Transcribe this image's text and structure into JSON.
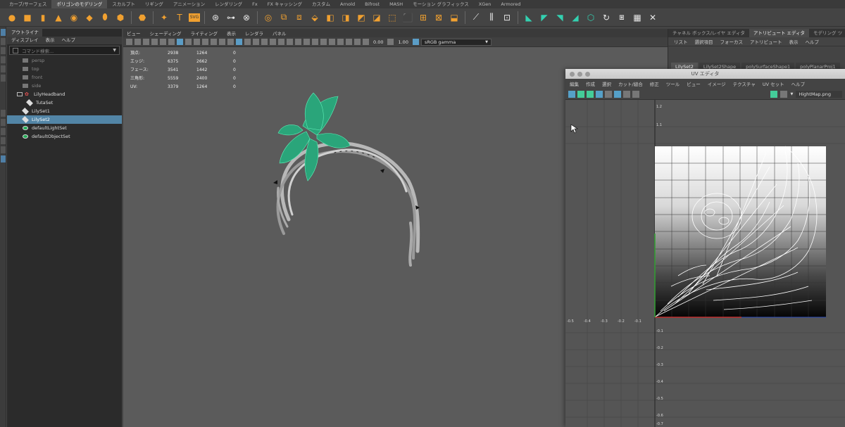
{
  "shelf": {
    "tabs": [
      "カーブ/サーフェス",
      "ポリゴンのモデリング",
      "スカルプト",
      "リギング",
      "アニメーション",
      "レンダリング",
      "Fx",
      "FX キャッシング",
      "カスタム",
      "Arnold",
      "Bifrost",
      "MASH",
      "モーション グラフィックス",
      "XGen",
      "Armored"
    ],
    "active_tab": "ポリゴンのモデリング",
    "text_icon": "T",
    "svg_icon": "SVG"
  },
  "outliner": {
    "title": "アウトライナ",
    "menu": [
      "ディスプレイ",
      "表示",
      "ヘルプ"
    ],
    "search_placeholder": "コマンド検索...",
    "items": [
      {
        "label": "persp",
        "icon": "camera-icon",
        "dim": true
      },
      {
        "label": "top",
        "icon": "camera-icon",
        "dim": true
      },
      {
        "label": "front",
        "icon": "camera-icon",
        "dim": true
      },
      {
        "label": "side",
        "icon": "camera-icon",
        "dim": true
      },
      {
        "label": "LilyHeadband",
        "icon": "mesh-icon",
        "dim": false
      },
      {
        "label": "TutaSet",
        "icon": "set-icon",
        "dim": false
      },
      {
        "label": "LilySet1",
        "icon": "set-icon",
        "dim": false
      },
      {
        "label": "LilySet2",
        "icon": "set-icon",
        "dim": false,
        "selected": true
      },
      {
        "label": "defaultLightSet",
        "icon": "object-set-icon",
        "dim": false
      },
      {
        "label": "defaultObjectSet",
        "icon": "object-set-icon",
        "dim": false
      }
    ]
  },
  "viewport": {
    "menu": [
      "ビュー",
      "シェーディング",
      "ライティング",
      "表示",
      "レンダラ",
      "パネル"
    ],
    "exposure": "0.00",
    "gamma": "1.00",
    "colorspace": "sRGB gamma",
    "hud": [
      {
        "label": "頂点:",
        "a": "2938",
        "b": "1264",
        "c": "0"
      },
      {
        "label": "エッジ:",
        "a": "6375",
        "b": "2662",
        "c": "0"
      },
      {
        "label": "フェース:",
        "a": "3541",
        "b": "1442",
        "c": "0"
      },
      {
        "label": "三角形:",
        "a": "5559",
        "b": "2400",
        "c": "0"
      },
      {
        "label": "UV:",
        "a": "3379",
        "b": "1264",
        "c": "0"
      }
    ]
  },
  "right_panel": {
    "tabs": [
      "チャネル ボックス/レイヤ エディタ",
      "アトリビュート エディタ",
      "モデリング ツ"
    ],
    "active_tab": "アトリビュート エディタ",
    "menu": [
      "リスト",
      "選択項目",
      "フォーカス",
      "アトリビュート",
      "表示",
      "ヘルプ"
    ],
    "nodes": [
      "LilySet2",
      "LilySet2Shape",
      "polySurfaceShape1",
      "polyPlanarProj1"
    ],
    "active_node": "LilySet2"
  },
  "uv_editor": {
    "title": "UV エディタ",
    "menu": [
      "編集",
      "作成",
      "選択",
      "カット/縫合",
      "修正",
      "ツール",
      "ビュー",
      "イメージ",
      "テクスチャ",
      "UV セット",
      "ヘルプ"
    ],
    "texture": "HightMap.png",
    "axis_labels_y": [
      "1.2",
      "1.1",
      "-0.1",
      "-0.2",
      "-0.3",
      "-0.4",
      "-0.5",
      "-0.6",
      "-0.7"
    ],
    "axis_labels_x": [
      "-0.5",
      "-0.4",
      "-0.3",
      "-0.2",
      "-0.1"
    ],
    "colors": {
      "bg": "#555555",
      "u_axis": "#c03030",
      "v_axis": "#30a030",
      "wire": "#ffffff"
    }
  },
  "colors": {
    "selected_bg": "#5285a6",
    "shelf_accent": "#f0a030",
    "shelf_teal": "#33d0b0",
    "model_green": "#45e0a0"
  }
}
